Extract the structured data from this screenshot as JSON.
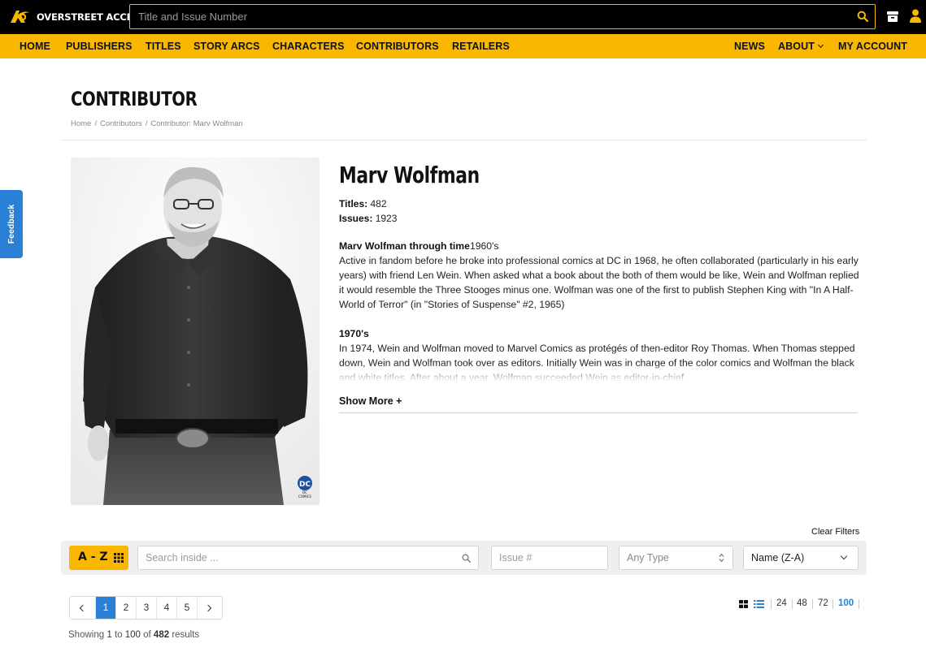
{
  "brand": {
    "name": "OVERSTREET ACCESS"
  },
  "search": {
    "placeholder": "Title and Issue Number"
  },
  "nav": {
    "left": [
      "HOME",
      "PUBLISHERS",
      "TITLES",
      "STORY ARCS",
      "CHARACTERS",
      "CONTRIBUTORS",
      "RETAILERS"
    ],
    "right": [
      "NEWS",
      "ABOUT",
      "MY ACCOUNT"
    ]
  },
  "header": {
    "title": "CONTRIBUTOR",
    "breadcrumb": [
      "Home",
      "Contributors",
      "Contributor: Marv Wolfman"
    ]
  },
  "feedback": {
    "label": "Feedback"
  },
  "contributor": {
    "name": "Marv Wolfman",
    "titles_label": "Titles:",
    "titles_value": "482",
    "issues_label": "Issues:",
    "issues_value": "1923",
    "bio_heading_1": "Marv Wolfman through time",
    "bio_sub_1": "1960's",
    "bio_text_1": "Active in fandom before he broke into professional comics at DC in 1968, he often collaborated (particularly in his early years) with friend Len Wein. When asked what a book about the both of them would be like, Wein and Wolfman replied it would resemble the Three Stooges minus one. Wolfman was one of the first to publish Stephen King with \"In A Half-World of Terror\" (in \"Stories of Suspense\" #2, 1965)",
    "bio_heading_2": "1970's",
    "bio_text_2": "In 1974, Wein and Wolfman moved to Marvel Comics as protégés of then-editor Roy Thomas. When Thomas stepped down, Wein and Wolfman took over as editors. Initially Wein was in charge of the color comics and Wolfman the black and white titles. After about a year, Wolfman succeeded Wein as editor-in-chief.",
    "show_more": "Show More +",
    "logo_text": "DC COMICS"
  },
  "filters": {
    "clear": "Clear Filters",
    "az_label": "A - Z",
    "search_placeholder": "Search inside ...",
    "issue_placeholder": "Issue #",
    "type_value": "Any Type",
    "sort_value": "Name (Z-A)"
  },
  "pagination": {
    "pages": [
      "1",
      "2",
      "3",
      "4",
      "5"
    ],
    "current": "1",
    "per_page": [
      "24",
      "48",
      "72",
      "100"
    ],
    "per_page_selected": "100"
  },
  "results": {
    "prefix": "Showing",
    "from": "1",
    "to_word": "to",
    "to": "100",
    "of_word": "of",
    "total": "482",
    "suffix": "results"
  },
  "colors": {
    "accent": "#f9b700",
    "link": "#2a7fd6",
    "topbar": "#000000"
  }
}
